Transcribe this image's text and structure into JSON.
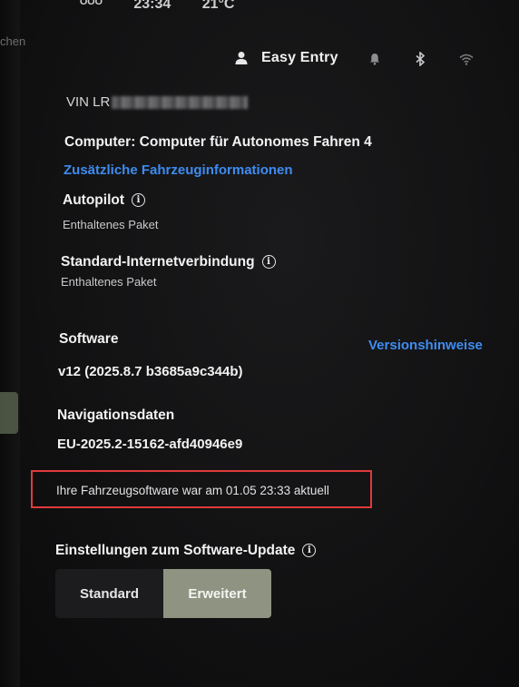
{
  "status_bar": {
    "partial_left": "ᴼᴼᴼ",
    "time": "23:34",
    "temperature": "21°C"
  },
  "left_partial_text": "chen",
  "header": {
    "profile_label": "Easy Entry",
    "icons": [
      "user-icon",
      "bell-icon",
      "bluetooth-icon",
      "wifi-icon"
    ]
  },
  "vehicle": {
    "vin_prefix": "VIN LR",
    "computer_label": "Computer: Computer für Autonomes Fahren 4",
    "more_info_link": "Zusätzliche Fahrzeuginformationen"
  },
  "autopilot": {
    "title": "Autopilot",
    "status": "Enthaltenes Paket"
  },
  "internet": {
    "title": "Standard-Internetverbindung",
    "status": "Enthaltenes Paket"
  },
  "software": {
    "title": "Software",
    "release_notes_link": "Versionshinweise",
    "version": "v12 (2025.8.7 b3685a9c344b)"
  },
  "navigation": {
    "title": "Navigationsdaten",
    "version": "EU-2025.2-15162-afd40946e9"
  },
  "update_status": "Ihre Fahrzeugsoftware war am 01.05 23:33 aktuell",
  "update_settings": {
    "title": "Einstellungen zum Software-Update",
    "options": [
      "Standard",
      "Erweitert"
    ],
    "selected": "Erweitert"
  },
  "colors": {
    "accent_link": "#3e8cf0",
    "selected_option": "#8f9482",
    "highlight_box": "#e03a3a"
  }
}
